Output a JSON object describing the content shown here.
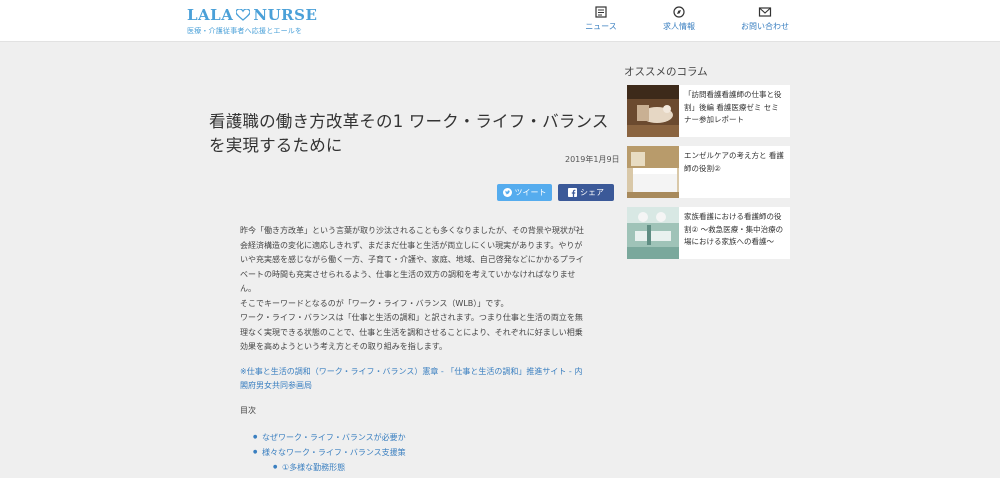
{
  "header": {
    "logo_left": "LALA",
    "logo_right": "NURSE",
    "tagline": "医療・介護従事者へ応援とエールを"
  },
  "nav": [
    {
      "label": "ニュース",
      "icon": "newspaper-icon"
    },
    {
      "label": "求人情報",
      "icon": "compass-icon"
    },
    {
      "label": "お問い合わせ",
      "icon": "mail-icon"
    }
  ],
  "article": {
    "title": "看護職の働き方改革その1 ワーク・ライフ・バランスを実現するために",
    "date": "2019年1月9日",
    "tweet_label": "ツイート",
    "share_label": "シェア",
    "paragraphs": [
      "昨今「働き方改革」という言葉が取り沙汰されることも多くなりましたが、その背景や現状が社会経済構造の変化に適応しきれず、まだまだ仕事と生活が両立しにくい現実があります。やりがいや充実感を感じながら働く一方、子育て・介護や、家庭、地域、自己啓発などにかかるプライベートの時間も充実させられるよう、仕事と生活の双方の調和を考えていかなければなりません。",
      "そこでキーワードとなるのが「ワーク・ライフ・バランス（WLB）」です。",
      "ワーク・ライフ・バランスは「仕事と生活の調和」と訳されます。つまり仕事と生活の両立を無理なく実現できる状態のことで、仕事と生活を調和させることにより、それぞれに好ましい相乗効果を高めようという考え方とその取り組みを指します。"
    ],
    "source_link": "※仕事と生活の調和（ワーク・ライフ・バランス）憲章 - 「仕事と生活の調和」推進サイト - 内閣府男女共同参画局",
    "toc_heading": "目次",
    "toc": [
      {
        "label": "なぜワーク・ライフ・バランスが必要か",
        "level": 1
      },
      {
        "label": "様々なワーク・ライフ・バランス支援策",
        "level": 1
      },
      {
        "label": "①多様な勤務形態",
        "level": 2
      }
    ]
  },
  "sidebar": {
    "heading": "オススメのコラム",
    "columns": [
      {
        "title": "「訪問看護看護師の仕事と役割」後編 看護医療ゼミ セミナー参加レポート"
      },
      {
        "title": "エンゼルケアの考え方と 看護師の役割②"
      },
      {
        "title": "家族看護における看護師の役割② ～救急医療・集中治療の場における家族への看護～"
      }
    ]
  },
  "colors": {
    "brand": "#4aa0d8",
    "link": "#3a7fc0",
    "twitter": "#55acee",
    "facebook": "#3b5998"
  }
}
